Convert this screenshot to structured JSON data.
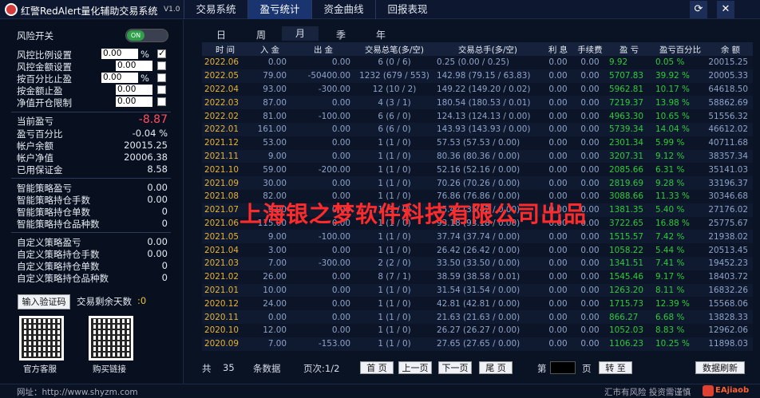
{
  "app": {
    "title": "红警RedAlert量化辅助交易系统",
    "version": "V1.0"
  },
  "tabs": [
    "交易系统",
    "盈亏统计",
    "资金曲线",
    "回报表现"
  ],
  "active_tab": 1,
  "window": {
    "refresh_icon": "refresh-icon",
    "close_icon": "close-icon"
  },
  "risk": {
    "switch_label": "风险开关",
    "switch_state": "ON",
    "settings": [
      {
        "label": "风控比例设置",
        "value": "0.00",
        "unit": "%",
        "checked": true
      },
      {
        "label": "风控金额设置",
        "value": "0.00",
        "unit": "",
        "checked": false
      },
      {
        "label": "按百分比止盈",
        "value": "0.00",
        "unit": "%",
        "checked": false
      },
      {
        "label": "按金额止盈",
        "value": "0.00",
        "unit": "",
        "checked": false
      },
      {
        "label": "净值开仓限制",
        "value": "0.00",
        "unit": "",
        "checked": false
      }
    ]
  },
  "account": [
    {
      "label": "当前盈亏",
      "value": "-8.87",
      "color": "#ff4d5e"
    },
    {
      "label": "盈亏百分比",
      "value": "-0.04 %"
    },
    {
      "label": "帐户余额",
      "value": "20015.25"
    },
    {
      "label": "帐户净值",
      "value": "20006.38"
    },
    {
      "label": "已用保证金",
      "value": "8.58"
    }
  ],
  "smart": [
    {
      "label": "智能策略盈亏",
      "value": "0.00"
    },
    {
      "label": "智能策略持仓手数",
      "value": "0.00"
    },
    {
      "label": "智能策略持仓单数",
      "value": "0"
    },
    {
      "label": "智能策略持仓品种数",
      "value": "0"
    }
  ],
  "custom": [
    {
      "label": "自定义策略盈亏",
      "value": "0.00"
    },
    {
      "label": "自定义策略持仓手数",
      "value": "0.00"
    },
    {
      "label": "自定义策略持仓单数",
      "value": "0"
    },
    {
      "label": "自定义策略持仓品种数",
      "value": "0"
    }
  ],
  "verify": {
    "button": "输入验证码",
    "days_label": "交易剩余天数",
    "days_value": ":0"
  },
  "qr": {
    "left_label": "官方客服",
    "right_label": "购买链接"
  },
  "footer": {
    "url": "网址：http://www.shyzm.com",
    "risk": "汇市有风险  投资需谨慎",
    "brand": "EAjiaob"
  },
  "periods": [
    "时 间",
    "日",
    "周",
    "月",
    "季",
    "年"
  ],
  "active_period": "月",
  "table": {
    "headers": [
      "时 间",
      "入 金",
      "出 金",
      "交易总笔(多/空)",
      "交易总手(多/空)",
      "利 息",
      "手续费",
      "盈 亏",
      "盈亏百分比",
      "余 额"
    ],
    "rows": [
      [
        "2022.06",
        "0.00",
        "0.00",
        "6 (0 / 6)",
        "0.25  (0.00 / 0.25)",
        "0.00",
        "0.00",
        "9.92",
        "0.05 %",
        "20015.25"
      ],
      [
        "2022.05",
        "79.00",
        "-50400.00",
        "1232 (679 / 553)",
        "142.98 (79.15 / 63.83)",
        "0.00",
        "0.00",
        "5707.83",
        "39.92 %",
        "20005.33"
      ],
      [
        "2022.04",
        "93.00",
        "-300.00",
        "12 (10 / 2)",
        "149.22 (149.20 / 0.02)",
        "0.00",
        "0.00",
        "5962.81",
        "10.17 %",
        "64618.50"
      ],
      [
        "2022.03",
        "87.00",
        "0.00",
        "4 (3 / 1)",
        "180.54 (180.53 / 0.01)",
        "0.00",
        "0.00",
        "7219.37",
        "13.98 %",
        "58862.69"
      ],
      [
        "2022.02",
        "81.00",
        "-100.00",
        "6 (6 / 0)",
        "124.13 (124.13 / 0.00)",
        "0.00",
        "0.00",
        "4963.30",
        "10.65 %",
        "51556.32"
      ],
      [
        "2022.01",
        "161.00",
        "0.00",
        "6 (6 / 0)",
        "143.93 (143.93 / 0.00)",
        "0.00",
        "0.00",
        "5739.34",
        "14.04 %",
        "46612.02"
      ],
      [
        "2021.12",
        "53.00",
        "0.00",
        "1 (1 / 0)",
        "57.53 (57.53 / 0.00)",
        "0.00",
        "0.00",
        "2301.34",
        "5.99 %",
        "40711.68"
      ],
      [
        "2021.11",
        "9.00",
        "0.00",
        "1 (1 / 0)",
        "80.36 (80.36 / 0.00)",
        "0.00",
        "0.00",
        "3207.31",
        "9.12 %",
        "38357.34"
      ],
      [
        "2021.10",
        "59.00",
        "-200.00",
        "1 (1 / 0)",
        "52.16 (52.16 / 0.00)",
        "0.00",
        "0.00",
        "2085.66",
        "6.31 %",
        "35141.03"
      ],
      [
        "2021.09",
        "30.00",
        "0.00",
        "1 (1 / 0)",
        "70.26 (70.26 / 0.00)",
        "0.00",
        "0.00",
        "2819.69",
        "9.28 %",
        "33196.37"
      ],
      [
        "2021.08",
        "82.00",
        "0.00",
        "1 (1 / 0)",
        "76.86 (76.86 / 0.00)",
        "0.00",
        "0.00",
        "3088.66",
        "11.33 %",
        "30346.68"
      ],
      [
        "2021.07",
        "9.00",
        "0.00",
        "1 (1 / 0)",
        "35.42 (35.42 / 0.00)",
        "0.00",
        "0.00",
        "1381.35",
        "5.40 %",
        "27176.02"
      ],
      [
        "2021.06",
        "115.00",
        "0.00",
        "1 (1 / 0)",
        "93.18 (93.18 / 0.00)",
        "0.00",
        "0.00",
        "3722.65",
        "16.88 %",
        "25775.67"
      ],
      [
        "2021.05",
        "9.00",
        "-100.00",
        "1 (1 / 0)",
        "37.74 (37.74 / 0.00)",
        "0.00",
        "0.00",
        "1515.57",
        "7.42 %",
        "21938.02"
      ],
      [
        "2021.04",
        "3.00",
        "0.00",
        "1 (1 / 0)",
        "26.42 (26.42 / 0.00)",
        "0.00",
        "0.00",
        "1058.22",
        "5.44 %",
        "20513.45"
      ],
      [
        "2021.03",
        "7.00",
        "-300.00",
        "2 (2 / 0)",
        "33.50 (33.50 / 0.00)",
        "0.00",
        "0.00",
        "1341.51",
        "7.41 %",
        "19452.23"
      ],
      [
        "2021.02",
        "26.00",
        "0.00",
        "8 (7 / 1)",
        "38.59 (38.58 / 0.01)",
        "0.00",
        "0.00",
        "1545.46",
        "9.17 %",
        "18403.72"
      ],
      [
        "2021.01",
        "10.00",
        "0.00",
        "1 (1 / 0)",
        "31.54 (31.54 / 0.00)",
        "0.00",
        "0.00",
        "1263.20",
        "8.11 %",
        "16832.26"
      ],
      [
        "2020.12",
        "24.00",
        "0.00",
        "1 (1 / 0)",
        "42.81 (42.81 / 0.00)",
        "0.00",
        "0.00",
        "1715.73",
        "12.39 %",
        "15568.06"
      ],
      [
        "2020.11",
        "0.00",
        "0.00",
        "1 (1 / 0)",
        "21.63 (21.63 / 0.00)",
        "0.00",
        "0.00",
        "866.27",
        "6.68 %",
        "13828.33"
      ],
      [
        "2020.10",
        "12.00",
        "0.00",
        "1 (1 / 0)",
        "26.27 (26.27 / 0.00)",
        "0.00",
        "0.00",
        "1052.03",
        "8.83 %",
        "12962.06"
      ],
      [
        "2020.09",
        "7.00",
        "-153.00",
        "1 (1 / 0)",
        "27.65 (27.65 / 0.00)",
        "0.00",
        "0.00",
        "1106.23",
        "10.25 %",
        "11898.03"
      ]
    ]
  },
  "watermark": "上海银之梦软件科技有限公司出品",
  "pager": {
    "total_prefix": "共",
    "total": "35",
    "total_suffix": "条数据",
    "page_label": "页次:1/2",
    "first": "首 页",
    "prev": "上一页",
    "next": "下一页",
    "last": "尾 页",
    "goto_prefix": "第",
    "goto_suffix": "页",
    "goto_button": "转 至",
    "refresh": "数据刷新"
  }
}
